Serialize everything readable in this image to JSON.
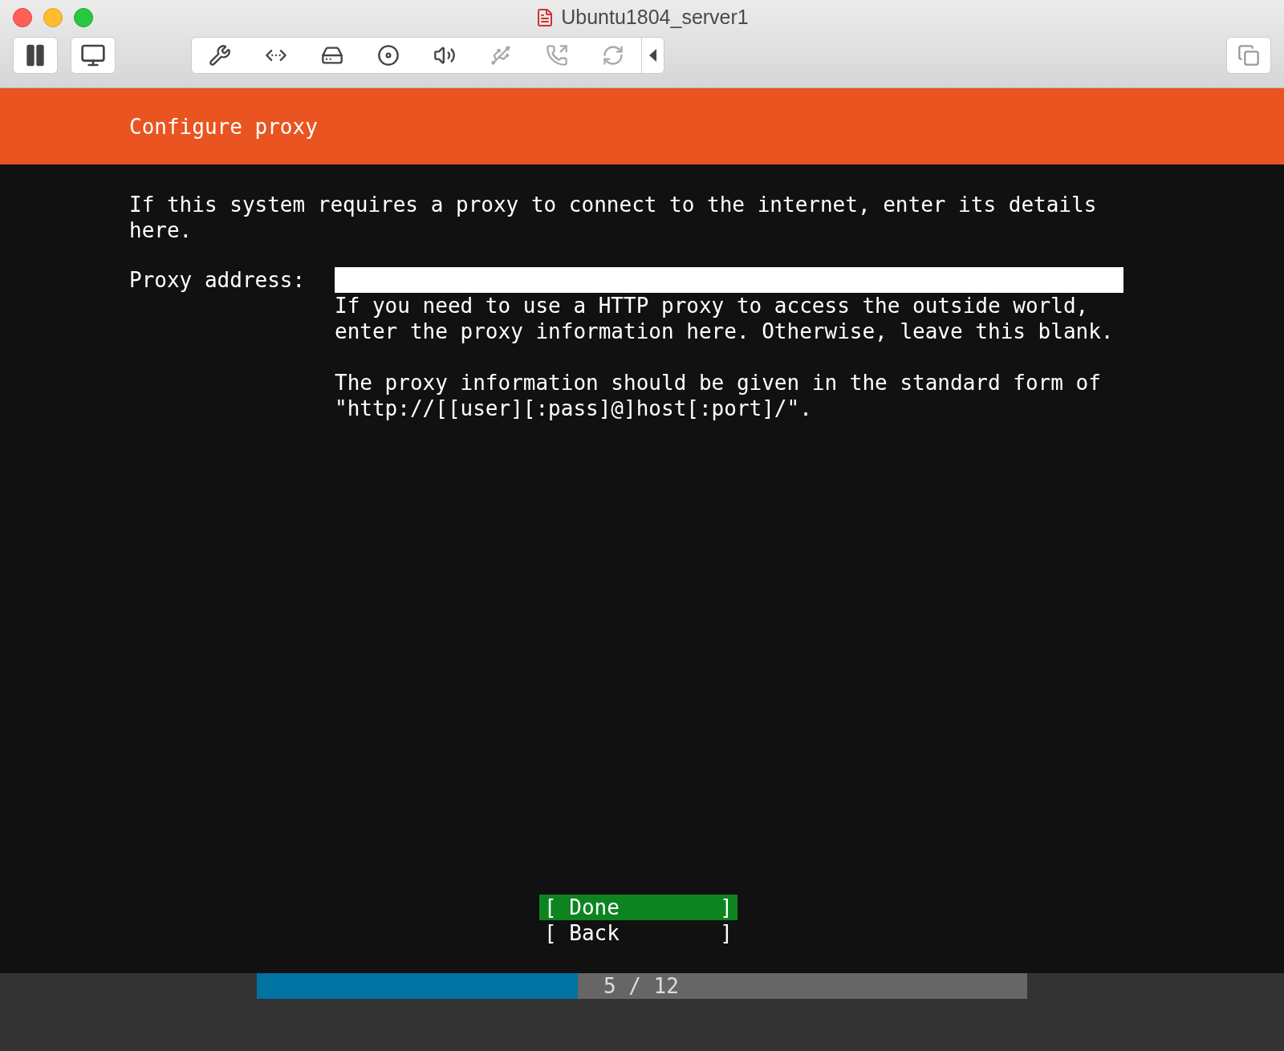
{
  "window": {
    "title": "Ubuntu1804_server1"
  },
  "header": {
    "title": "Configure proxy"
  },
  "intro": "If this system requires a proxy to connect to the internet, enter its details here.",
  "proxy_field": {
    "label": "Proxy address:",
    "help": [
      "If you need to use a HTTP proxy to access the outside world, enter the proxy information here. Otherwise, leave this blank.",
      "The proxy information should be given in the standard form of \"http://[[user][:pass]@]host[:port]/\"."
    ]
  },
  "buttons": [
    {
      "label": "[ Done        ]",
      "selected": true
    },
    {
      "label": "[ Back        ]",
      "selected": false
    }
  ],
  "progress": {
    "level": 0.417,
    "text": "5 / 12"
  }
}
